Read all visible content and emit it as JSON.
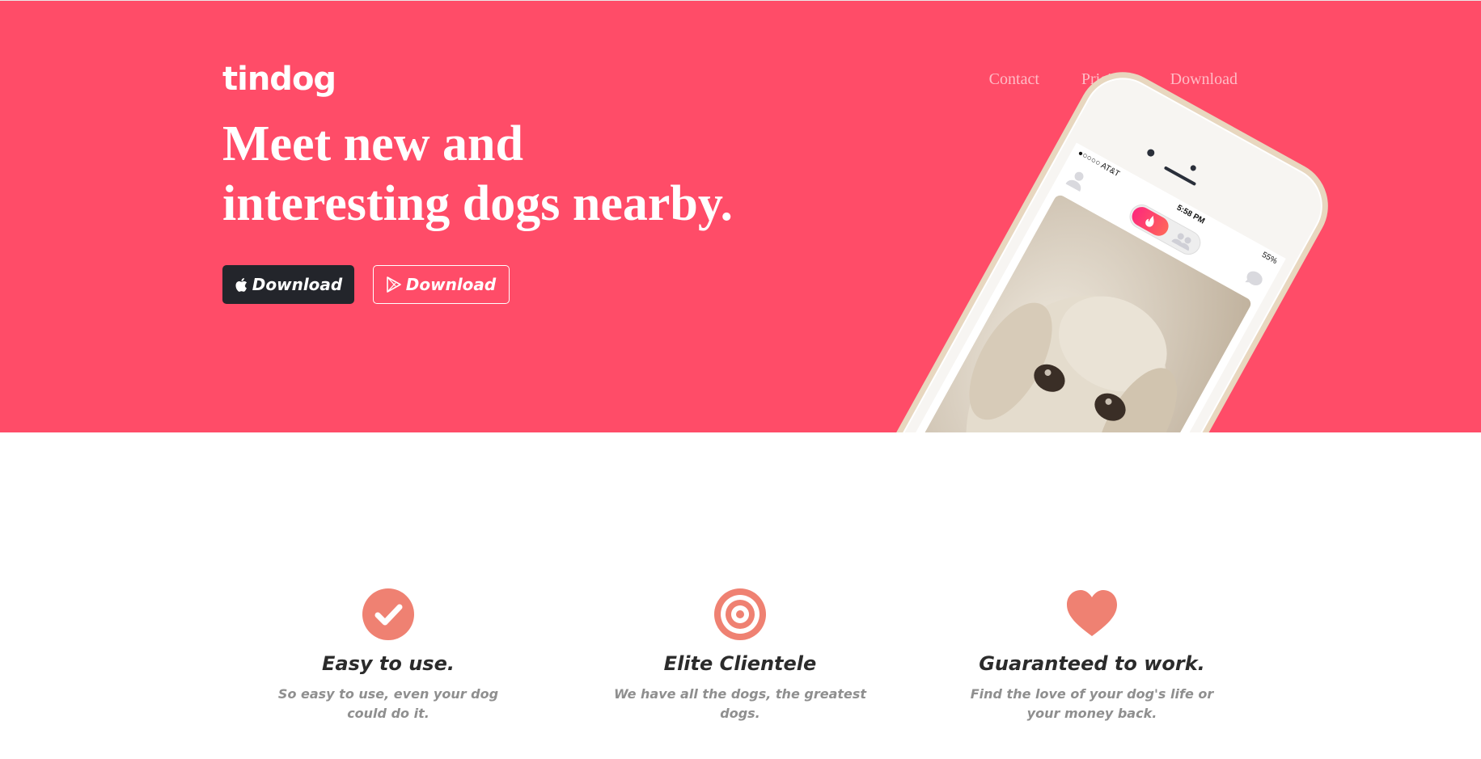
{
  "brand": {
    "name": "tindog"
  },
  "nav": {
    "items": [
      "Contact",
      "Pricing",
      "Download"
    ]
  },
  "hero": {
    "headline_line1": "Meet new and",
    "headline_line2": "interesting dogs nearby.",
    "apple_button": {
      "label": "Download",
      "icon": "apple-icon"
    },
    "play_button": {
      "label": "Download",
      "icon": "google-play-icon"
    }
  },
  "phone": {
    "carrier": "●○○○○ AT&T",
    "time": "5:58 PM",
    "battery": "55%"
  },
  "features": [
    {
      "icon": "check-circle-icon",
      "title": "Easy to use.",
      "desc": "So easy to use, even your dog could do it."
    },
    {
      "icon": "bullseye-icon",
      "title": "Elite Clientele",
      "desc": "We have all the dogs, the greatest dogs."
    },
    {
      "icon": "heart-icon",
      "title": "Guaranteed to work.",
      "desc": "Find the love of your dog's life or your money back."
    }
  ],
  "colors": {
    "hero_bg": "#ff4c68",
    "accent": "#ef8172",
    "dark_button": "#23252b"
  }
}
